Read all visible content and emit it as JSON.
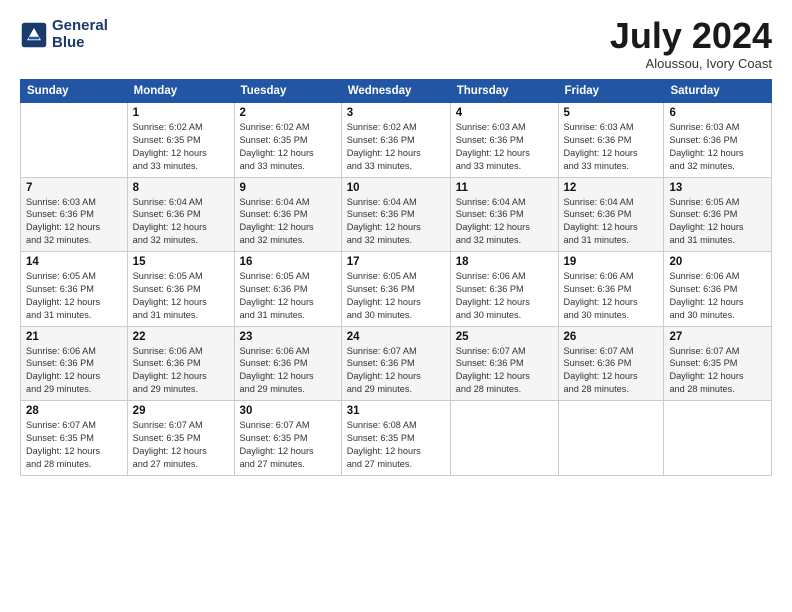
{
  "logo": {
    "line1": "General",
    "line2": "Blue"
  },
  "title": {
    "month_year": "July 2024",
    "location": "Aloussou, Ivory Coast"
  },
  "days_of_week": [
    "Sunday",
    "Monday",
    "Tuesday",
    "Wednesday",
    "Thursday",
    "Friday",
    "Saturday"
  ],
  "weeks": [
    [
      {
        "num": "",
        "info": ""
      },
      {
        "num": "1",
        "info": "Sunrise: 6:02 AM\nSunset: 6:35 PM\nDaylight: 12 hours\nand 33 minutes."
      },
      {
        "num": "2",
        "info": "Sunrise: 6:02 AM\nSunset: 6:35 PM\nDaylight: 12 hours\nand 33 minutes."
      },
      {
        "num": "3",
        "info": "Sunrise: 6:02 AM\nSunset: 6:36 PM\nDaylight: 12 hours\nand 33 minutes."
      },
      {
        "num": "4",
        "info": "Sunrise: 6:03 AM\nSunset: 6:36 PM\nDaylight: 12 hours\nand 33 minutes."
      },
      {
        "num": "5",
        "info": "Sunrise: 6:03 AM\nSunset: 6:36 PM\nDaylight: 12 hours\nand 33 minutes."
      },
      {
        "num": "6",
        "info": "Sunrise: 6:03 AM\nSunset: 6:36 PM\nDaylight: 12 hours\nand 32 minutes."
      }
    ],
    [
      {
        "num": "7",
        "info": "Sunrise: 6:03 AM\nSunset: 6:36 PM\nDaylight: 12 hours\nand 32 minutes."
      },
      {
        "num": "8",
        "info": "Sunrise: 6:04 AM\nSunset: 6:36 PM\nDaylight: 12 hours\nand 32 minutes."
      },
      {
        "num": "9",
        "info": "Sunrise: 6:04 AM\nSunset: 6:36 PM\nDaylight: 12 hours\nand 32 minutes."
      },
      {
        "num": "10",
        "info": "Sunrise: 6:04 AM\nSunset: 6:36 PM\nDaylight: 12 hours\nand 32 minutes."
      },
      {
        "num": "11",
        "info": "Sunrise: 6:04 AM\nSunset: 6:36 PM\nDaylight: 12 hours\nand 32 minutes."
      },
      {
        "num": "12",
        "info": "Sunrise: 6:04 AM\nSunset: 6:36 PM\nDaylight: 12 hours\nand 31 minutes."
      },
      {
        "num": "13",
        "info": "Sunrise: 6:05 AM\nSunset: 6:36 PM\nDaylight: 12 hours\nand 31 minutes."
      }
    ],
    [
      {
        "num": "14",
        "info": "Sunrise: 6:05 AM\nSunset: 6:36 PM\nDaylight: 12 hours\nand 31 minutes."
      },
      {
        "num": "15",
        "info": "Sunrise: 6:05 AM\nSunset: 6:36 PM\nDaylight: 12 hours\nand 31 minutes."
      },
      {
        "num": "16",
        "info": "Sunrise: 6:05 AM\nSunset: 6:36 PM\nDaylight: 12 hours\nand 31 minutes."
      },
      {
        "num": "17",
        "info": "Sunrise: 6:05 AM\nSunset: 6:36 PM\nDaylight: 12 hours\nand 30 minutes."
      },
      {
        "num": "18",
        "info": "Sunrise: 6:06 AM\nSunset: 6:36 PM\nDaylight: 12 hours\nand 30 minutes."
      },
      {
        "num": "19",
        "info": "Sunrise: 6:06 AM\nSunset: 6:36 PM\nDaylight: 12 hours\nand 30 minutes."
      },
      {
        "num": "20",
        "info": "Sunrise: 6:06 AM\nSunset: 6:36 PM\nDaylight: 12 hours\nand 30 minutes."
      }
    ],
    [
      {
        "num": "21",
        "info": "Sunrise: 6:06 AM\nSunset: 6:36 PM\nDaylight: 12 hours\nand 29 minutes."
      },
      {
        "num": "22",
        "info": "Sunrise: 6:06 AM\nSunset: 6:36 PM\nDaylight: 12 hours\nand 29 minutes."
      },
      {
        "num": "23",
        "info": "Sunrise: 6:06 AM\nSunset: 6:36 PM\nDaylight: 12 hours\nand 29 minutes."
      },
      {
        "num": "24",
        "info": "Sunrise: 6:07 AM\nSunset: 6:36 PM\nDaylight: 12 hours\nand 29 minutes."
      },
      {
        "num": "25",
        "info": "Sunrise: 6:07 AM\nSunset: 6:36 PM\nDaylight: 12 hours\nand 28 minutes."
      },
      {
        "num": "26",
        "info": "Sunrise: 6:07 AM\nSunset: 6:36 PM\nDaylight: 12 hours\nand 28 minutes."
      },
      {
        "num": "27",
        "info": "Sunrise: 6:07 AM\nSunset: 6:35 PM\nDaylight: 12 hours\nand 28 minutes."
      }
    ],
    [
      {
        "num": "28",
        "info": "Sunrise: 6:07 AM\nSunset: 6:35 PM\nDaylight: 12 hours\nand 28 minutes."
      },
      {
        "num": "29",
        "info": "Sunrise: 6:07 AM\nSunset: 6:35 PM\nDaylight: 12 hours\nand 27 minutes."
      },
      {
        "num": "30",
        "info": "Sunrise: 6:07 AM\nSunset: 6:35 PM\nDaylight: 12 hours\nand 27 minutes."
      },
      {
        "num": "31",
        "info": "Sunrise: 6:08 AM\nSunset: 6:35 PM\nDaylight: 12 hours\nand 27 minutes."
      },
      {
        "num": "",
        "info": ""
      },
      {
        "num": "",
        "info": ""
      },
      {
        "num": "",
        "info": ""
      }
    ]
  ]
}
